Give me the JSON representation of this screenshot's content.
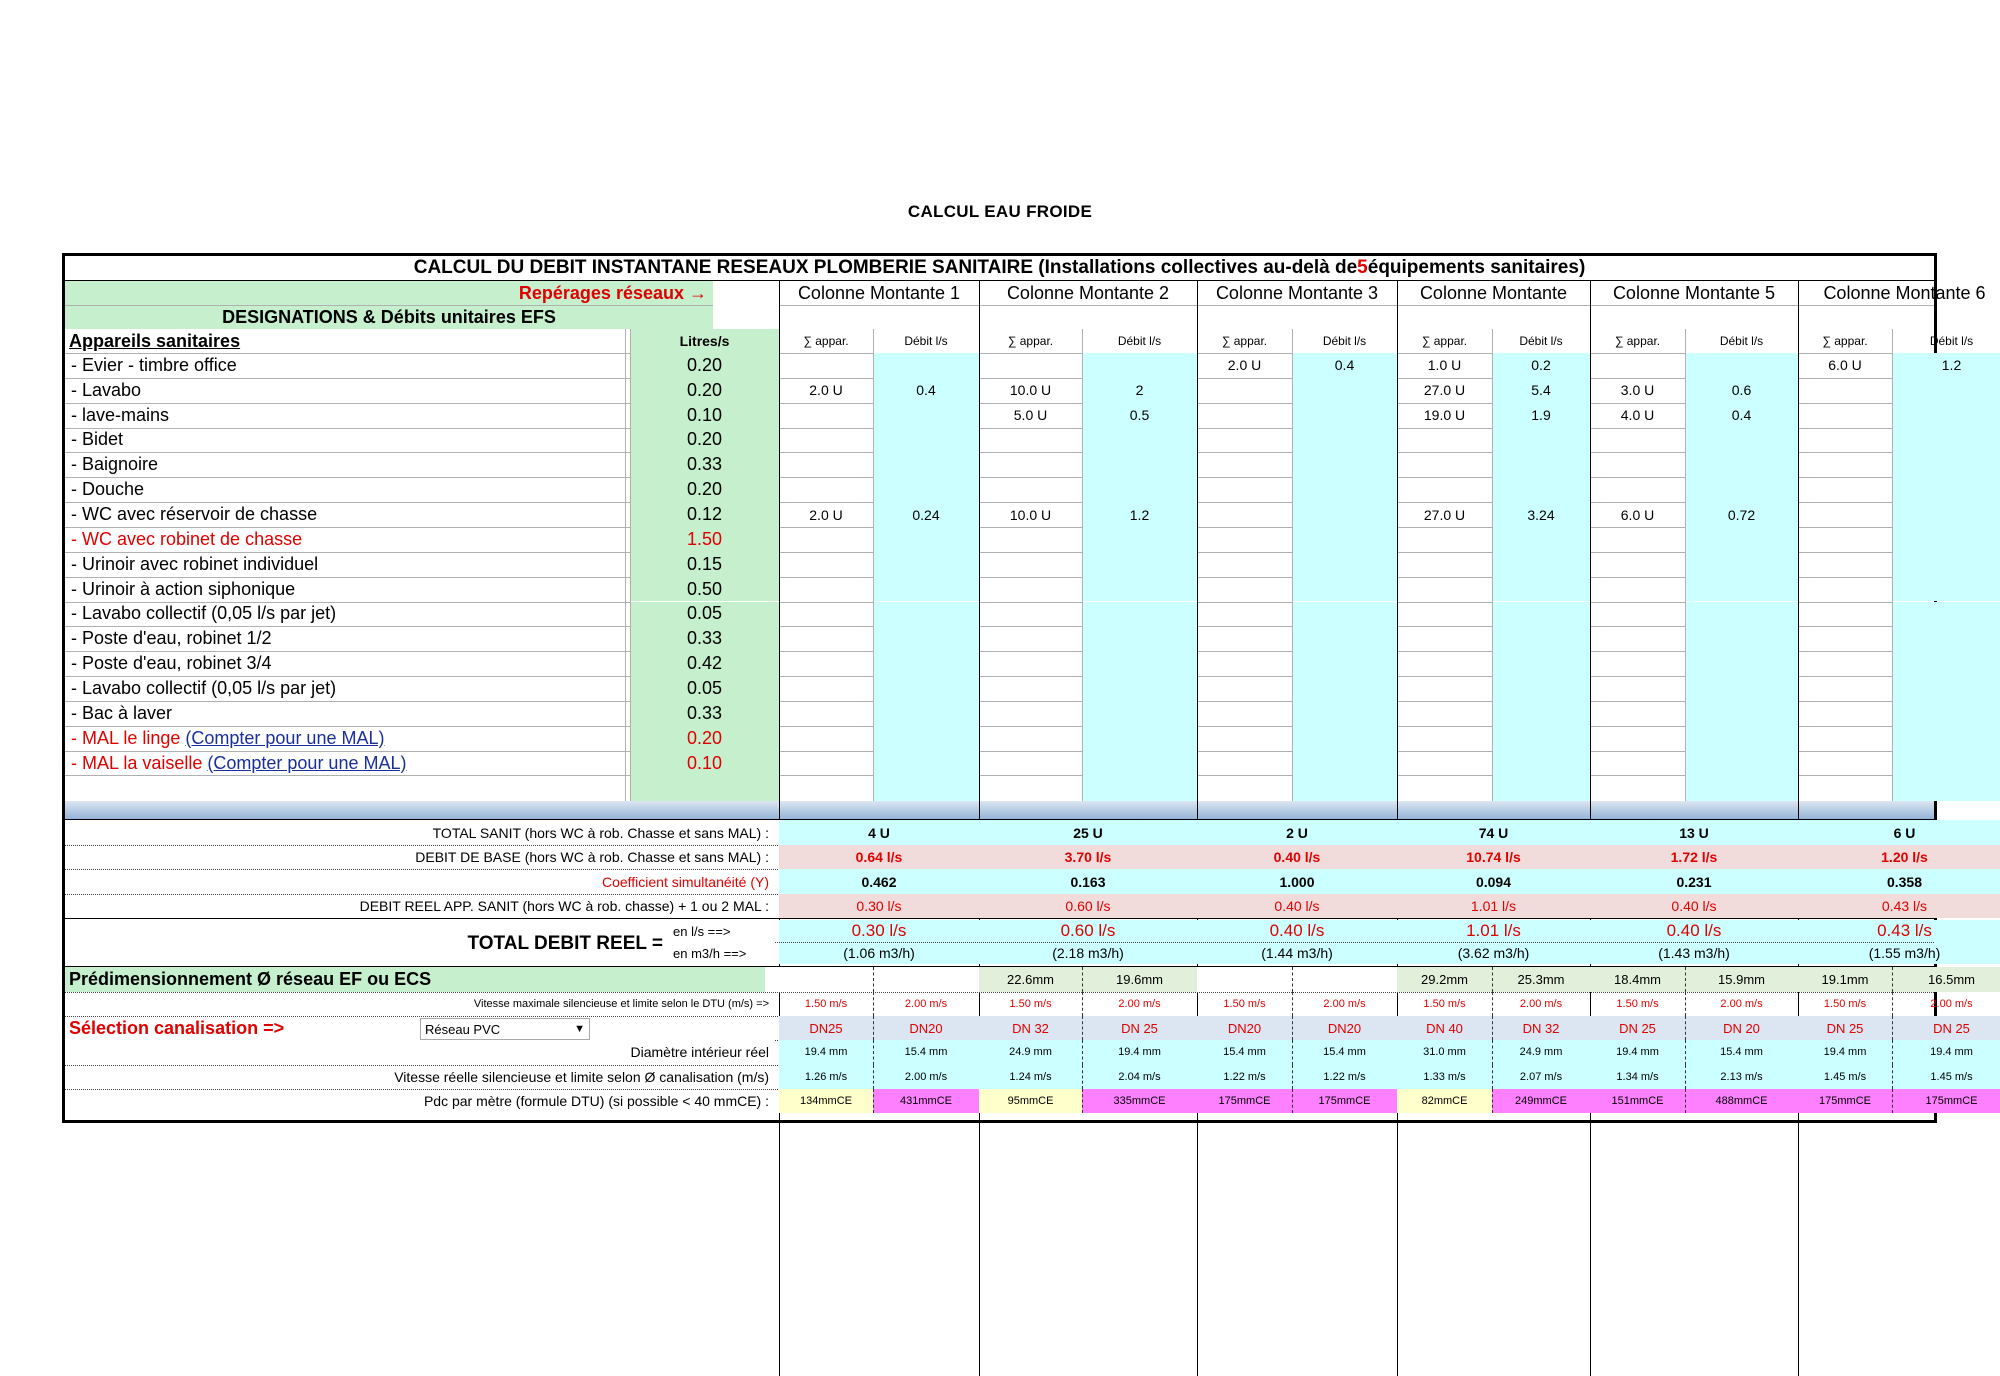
{
  "page": {
    "title": "CALCUL EAU FROIDE"
  },
  "banner": {
    "prefix": "CALCUL DU DEBIT INSTANTANE RESEAUX PLOMBERIE SANITAIRE (Installations collectives au-delà de ",
    "count": "5",
    "suffix": " équipements sanitaires)"
  },
  "header": {
    "reperages": "Repérages réseaux →",
    "designations": "DESIGNATIONS & Débits unitaires EFS",
    "appareils": "Appareils sanitaires",
    "litres": "Litres/s",
    "columns": [
      "Colonne  Montante 1",
      "Colonne  Montante 2",
      "Colonne  Montante 3",
      "Colonne  Montante",
      "Colonne  Montante 5",
      "Colonne  Montante 6"
    ],
    "sub_sum": "∑ appar.",
    "sub_debit": "Débit l/s"
  },
  "fixtures": [
    {
      "name": "- Evier - timbre office",
      "rate": "0.20",
      "red": false,
      "vals": [
        [
          "",
          ""
        ],
        [
          "",
          ""
        ],
        [
          "2.0 U",
          "0.4"
        ],
        [
          "1.0 U",
          "0.2"
        ],
        [
          "",
          ""
        ],
        [
          "6.0 U",
          "1.2"
        ]
      ]
    },
    {
      "name": "- Lavabo",
      "rate": "0.20",
      "red": false,
      "vals": [
        [
          "2.0 U",
          "0.4"
        ],
        [
          "10.0 U",
          "2"
        ],
        [
          "",
          ""
        ],
        [
          "27.0 U",
          "5.4"
        ],
        [
          "3.0 U",
          "0.6"
        ],
        [
          "",
          ""
        ]
      ]
    },
    {
      "name": "- lave-mains",
      "rate": "0.10",
      "red": false,
      "vals": [
        [
          "",
          ""
        ],
        [
          "5.0 U",
          "0.5"
        ],
        [
          "",
          ""
        ],
        [
          "19.0 U",
          "1.9"
        ],
        [
          "4.0 U",
          "0.4"
        ],
        [
          "",
          ""
        ]
      ]
    },
    {
      "name": "- Bidet",
      "rate": "0.20",
      "red": false,
      "vals": [
        [
          "",
          ""
        ],
        [
          "",
          ""
        ],
        [
          "",
          ""
        ],
        [
          "",
          ""
        ],
        [
          "",
          ""
        ],
        [
          "",
          ""
        ]
      ]
    },
    {
      "name": "- Baignoire",
      "rate": "0.33",
      "red": false,
      "vals": [
        [
          "",
          ""
        ],
        [
          "",
          ""
        ],
        [
          "",
          ""
        ],
        [
          "",
          ""
        ],
        [
          "",
          ""
        ],
        [
          "",
          ""
        ]
      ]
    },
    {
      "name": "- Douche",
      "rate": "0.20",
      "red": false,
      "vals": [
        [
          "",
          ""
        ],
        [
          "",
          ""
        ],
        [
          "",
          ""
        ],
        [
          "",
          ""
        ],
        [
          "",
          ""
        ],
        [
          "",
          ""
        ]
      ]
    },
    {
      "name": "- WC avec réservoir de chasse",
      "rate": "0.12",
      "red": false,
      "vals": [
        [
          "2.0 U",
          "0.24"
        ],
        [
          "10.0 U",
          "1.2"
        ],
        [
          "",
          ""
        ],
        [
          "27.0 U",
          "3.24"
        ],
        [
          "6.0 U",
          "0.72"
        ],
        [
          "",
          ""
        ]
      ]
    },
    {
      "name": "- WC avec robinet de chasse",
      "rate": "1.50",
      "red": true,
      "vals": [
        [
          "",
          ""
        ],
        [
          "",
          ""
        ],
        [
          "",
          ""
        ],
        [
          "",
          ""
        ],
        [
          "",
          ""
        ],
        [
          "",
          ""
        ]
      ]
    },
    {
      "name": "- Urinoir avec robinet individuel",
      "rate": "0.15",
      "red": false,
      "vals": [
        [
          "",
          ""
        ],
        [
          "",
          ""
        ],
        [
          "",
          ""
        ],
        [
          "",
          ""
        ],
        [
          "",
          ""
        ],
        [
          "",
          ""
        ]
      ]
    },
    {
      "name": "- Urinoir à action siphonique",
      "rate": "0.50",
      "red": false,
      "vals": [
        [
          "",
          ""
        ],
        [
          "",
          ""
        ],
        [
          "",
          ""
        ],
        [
          "",
          ""
        ],
        [
          "",
          ""
        ],
        [
          "",
          ""
        ]
      ]
    },
    {
      "name": "- Lavabo collectif (0,05 l/s par jet)",
      "rate": "0.05",
      "red": false,
      "vals": [
        [
          "",
          ""
        ],
        [
          "",
          ""
        ],
        [
          "",
          ""
        ],
        [
          "",
          ""
        ],
        [
          "",
          ""
        ],
        [
          "",
          ""
        ]
      ]
    },
    {
      "name": "- Poste d'eau, robinet 1/2",
      "rate": "0.33",
      "red": false,
      "vals": [
        [
          "",
          ""
        ],
        [
          "",
          ""
        ],
        [
          "",
          ""
        ],
        [
          "",
          ""
        ],
        [
          "",
          ""
        ],
        [
          "",
          ""
        ]
      ]
    },
    {
      "name": "- Poste d'eau, robinet 3/4",
      "rate": "0.42",
      "red": false,
      "vals": [
        [
          "",
          ""
        ],
        [
          "",
          ""
        ],
        [
          "",
          ""
        ],
        [
          "",
          ""
        ],
        [
          "",
          ""
        ],
        [
          "",
          ""
        ]
      ]
    },
    {
      "name": "- Lavabo collectif (0,05 l/s par jet)",
      "rate": "0.05",
      "red": false,
      "vals": [
        [
          "",
          ""
        ],
        [
          "",
          ""
        ],
        [
          "",
          ""
        ],
        [
          "",
          ""
        ],
        [
          "",
          ""
        ],
        [
          "",
          ""
        ]
      ]
    },
    {
      "name": "- Bac à laver",
      "rate": "0.33",
      "red": false,
      "vals": [
        [
          "",
          ""
        ],
        [
          "",
          ""
        ],
        [
          "",
          ""
        ],
        [
          "",
          ""
        ],
        [
          "",
          ""
        ],
        [
          "",
          ""
        ]
      ]
    },
    {
      "name": "- MAL le linge ",
      "link": "(Compter pour une MAL)",
      "rate": "0.20",
      "red": true,
      "vals": [
        [
          "",
          ""
        ],
        [
          "",
          ""
        ],
        [
          "",
          ""
        ],
        [
          "",
          ""
        ],
        [
          "",
          ""
        ],
        [
          "",
          ""
        ]
      ]
    },
    {
      "name": "- MAL la vaiselle ",
      "link": "(Compter pour une MAL)",
      "rate": "0.10",
      "red": true,
      "vals": [
        [
          "",
          ""
        ],
        [
          "",
          ""
        ],
        [
          "",
          ""
        ],
        [
          "",
          ""
        ],
        [
          "",
          ""
        ],
        [
          "",
          ""
        ]
      ]
    }
  ],
  "totals": {
    "total_sanit_label": "TOTAL  SANIT  (hors WC à rob. Chasse et sans MAL) :",
    "total_sanit": [
      "4 U",
      "25 U",
      "2 U",
      "74 U",
      "13 U",
      "6 U"
    ],
    "debit_base_label": "DEBIT DE BASE (hors WC à rob. Chasse et sans MAL) :",
    "debit_base": [
      "0.64 l/s",
      "3.70 l/s",
      "0.40 l/s",
      "10.74 l/s",
      "1.72 l/s",
      "1.20 l/s"
    ],
    "coef_label": "Coefficient simultanéité (Y)",
    "coef": [
      "0.462",
      "0.163",
      "1.000",
      "0.094",
      "0.231",
      "0.358"
    ],
    "debit_reel_label": "DEBIT REEL  APP. SANIT (hors WC à rob. chasse) + 1 ou 2 MAL :",
    "debit_reel": [
      "0.30 l/s",
      "0.60 l/s",
      "0.40 l/s",
      "1.01 l/s",
      "0.40 l/s",
      "0.43 l/s"
    ],
    "total_reel_label": "TOTAL DEBIT REEL =",
    "unit_ls": "en l/s ==>",
    "unit_m3h": "en m3/h ==>",
    "total_reel_ls": [
      "0.30 l/s",
      "0.60 l/s",
      "0.40 l/s",
      "1.01 l/s",
      "0.40 l/s",
      "0.43 l/s"
    ],
    "total_reel_m3h": [
      "(1.06 m3/h)",
      "(2.18 m3/h)",
      "(1.44 m3/h)",
      "(3.62 m3/h)",
      "(1.43 m3/h)",
      "(1.55 m3/h)"
    ]
  },
  "sizing": {
    "title": "Prédimensionnement Ø réseau EF ou ECS",
    "predim": [
      [
        "",
        ""
      ],
      [
        "22.6mm",
        "19.6mm"
      ],
      [
        "",
        ""
      ],
      [
        "29.2mm",
        "25.3mm"
      ],
      [
        "18.4mm",
        "15.9mm"
      ],
      [
        "19.1mm",
        "16.5mm"
      ]
    ],
    "vmax_label": "Vitesse maximale silencieuse et limite selon le DTU (m/s) =>",
    "vmax": [
      [
        "1.50 m/s",
        "2.00 m/s"
      ],
      [
        "1.50 m/s",
        "2.00 m/s"
      ],
      [
        "1.50 m/s",
        "2.00 m/s"
      ],
      [
        "1.50 m/s",
        "2.00 m/s"
      ],
      [
        "1.50 m/s",
        "2.00 m/s"
      ],
      [
        "1.50 m/s",
        "2.00 m/s"
      ]
    ],
    "selection_label": "Sélection canalisation =>",
    "selection_value": "Réseau PVC",
    "dn": [
      [
        "DN25",
        "DN20"
      ],
      [
        "DN 32",
        "DN 25"
      ],
      [
        "DN20",
        "DN20"
      ],
      [
        "DN 40",
        "DN 32"
      ],
      [
        "DN 25",
        "DN 20"
      ],
      [
        "DN 25",
        "DN 25"
      ]
    ],
    "diam_label": "Diamètre intérieur réel",
    "diam": [
      [
        "19.4 mm",
        "15.4 mm"
      ],
      [
        "24.9 mm",
        "19.4 mm"
      ],
      [
        "15.4 mm",
        "15.4 mm"
      ],
      [
        "31.0 mm",
        "24.9 mm"
      ],
      [
        "19.4 mm",
        "15.4 mm"
      ],
      [
        "19.4 mm",
        "19.4 mm"
      ]
    ],
    "vreal_label": "Vitesse réelle silencieuse et limite selon Ø canalisation (m/s)",
    "vreal": [
      [
        "1.26 m/s",
        "2.00 m/s"
      ],
      [
        "1.24 m/s",
        "2.04 m/s"
      ],
      [
        "1.22 m/s",
        "1.22 m/s"
      ],
      [
        "1.33 m/s",
        "2.07 m/s"
      ],
      [
        "1.34 m/s",
        "2.13 m/s"
      ],
      [
        "1.45 m/s",
        "1.45 m/s"
      ]
    ],
    "pdc_label": "Pdc par mètre (formule DTU) (si possible < 40 mmCE) :",
    "pdc": [
      [
        "134mmCE",
        "431mmCE"
      ],
      [
        "95mmCE",
        "335mmCE"
      ],
      [
        "175mmCE",
        "175mmCE"
      ],
      [
        "82mmCE",
        "249mmCE"
      ],
      [
        "151mmCE",
        "488mmCE"
      ],
      [
        "175mmCE",
        "175mmCE"
      ]
    ]
  },
  "colors": {
    "green": "#c6efce",
    "cyan": "#ccffff",
    "red": "#e00000",
    "yellow": "#ffffcc",
    "magenta": "#ff80ff",
    "link": "#1a2e9e"
  }
}
